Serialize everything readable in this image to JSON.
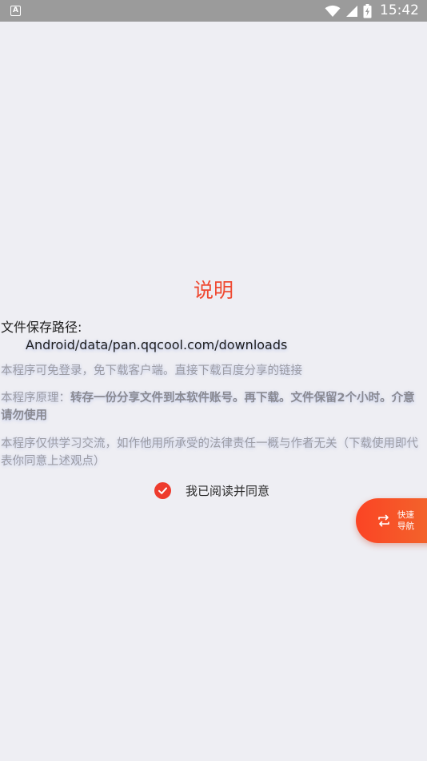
{
  "status_bar": {
    "app_icon_letter": "A",
    "time": "15:42"
  },
  "dialog": {
    "title": "说明",
    "path_label": "文件保存路径:",
    "path_value": "Android/data/pan.qqcool.com/downloads",
    "note1": "本程序可免登录，免下载客户端。直接下载百度分享的链接",
    "note2_prefix": "本程序原理：",
    "note2_strong": "转存一份分享文件到本软件账号。再下载。文件保留2个小时。介意请勿使用",
    "note3": "本程序仅供学习交流，如作他用所承受的法律责任一概与作者无关（下载使用即代表你同意上述观点）",
    "agree_label": "我已阅读并同意",
    "agree_checked": true
  },
  "fab": {
    "line1": "快速",
    "line2": "导航"
  },
  "colors": {
    "accent": "#ef4a32",
    "status_bar": "#9b9b9b",
    "background": "#eeeef3",
    "fab_gradient_start": "#fb4424",
    "fab_gradient_end": "#f2662c"
  },
  "icons": {
    "status_app": "app-notification-icon",
    "wifi": "wifi-icon",
    "signal": "cell-signal-icon",
    "battery": "battery-charging-icon",
    "check": "check-circle-icon",
    "fab": "swap-icon"
  }
}
